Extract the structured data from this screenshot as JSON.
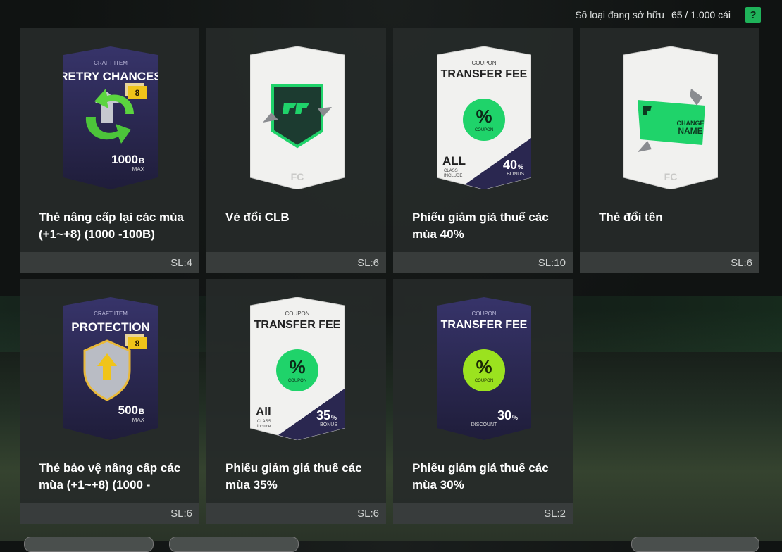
{
  "header": {
    "owned_label": "Số loại đang sở hữu",
    "owned_count": "65 / 1.000 cái",
    "help_label": "?"
  },
  "items": [
    {
      "name": "Thẻ nâng cấp lại các mùa (+1~+8) (1000 -100B)",
      "qty": "SL:4",
      "card": {
        "style": "dark",
        "kicker": "CRAFT ITEM",
        "heading": "RETRY CHANCES",
        "badge": "8",
        "value": "1000",
        "unit": "B",
        "sub": "MAX",
        "icon": "retry-arrows-icon"
      }
    },
    {
      "name": "Vé đổi CLB",
      "qty": "SL:6",
      "card": {
        "style": "light",
        "icon": "club-transfer-icon"
      }
    },
    {
      "name": "Phiếu giảm giá thuế các mùa 40%",
      "qty": "SL:10",
      "card": {
        "style": "light",
        "kicker": "COUPON",
        "heading": "TRANSFER FEE",
        "badge_text": "%",
        "badge_sub": "COUPON",
        "left_big": "ALL",
        "left_small": "CLASS\nINCLUDE",
        "value": "40",
        "unit": "%",
        "sub": "BONUS",
        "icon": "coupon-icon"
      }
    },
    {
      "name": "Thẻ đổi tên",
      "qty": "SL:6",
      "card": {
        "style": "light",
        "change_line1": "CHANGE",
        "change_line2": "NAME",
        "icon": "change-name-icon"
      }
    },
    {
      "name": "Thẻ bảo vệ nâng cấp các mùa (+1~+8) (1000 -",
      "qty": "SL:6",
      "card": {
        "style": "dark",
        "kicker": "CRAFT ITEM",
        "heading": "PROTECTION",
        "badge": "8",
        "value": "500",
        "unit": "B",
        "sub": "MAX",
        "icon": "shield-icon"
      }
    },
    {
      "name": "Phiếu giảm giá thuế các mùa 35%",
      "qty": "SL:6",
      "card": {
        "style": "light",
        "kicker": "COUPON",
        "heading": "TRANSFER FEE",
        "badge_text": "%",
        "badge_sub": "COUPON",
        "left_big": "All",
        "left_small": "CLASS\nInclude",
        "value": "35",
        "unit": "%",
        "sub": "BONUS",
        "icon": "coupon-icon"
      }
    },
    {
      "name": "Phiếu giảm giá thuế các mùa 30%",
      "qty": "SL:2",
      "card": {
        "style": "dark",
        "kicker": "COUPON",
        "heading": "TRANSFER FEE",
        "badge_text": "%",
        "badge_sub": "COUPON",
        "value": "30",
        "unit": "%",
        "sub": "DISCOUNT",
        "icon": "coupon-icon"
      }
    }
  ],
  "colors": {
    "accent_green": "#1fd36a",
    "lime": "#9be21f",
    "card_dark": "#2a2750",
    "card_light": "#f2f2f0",
    "gold": "#f0c419"
  }
}
